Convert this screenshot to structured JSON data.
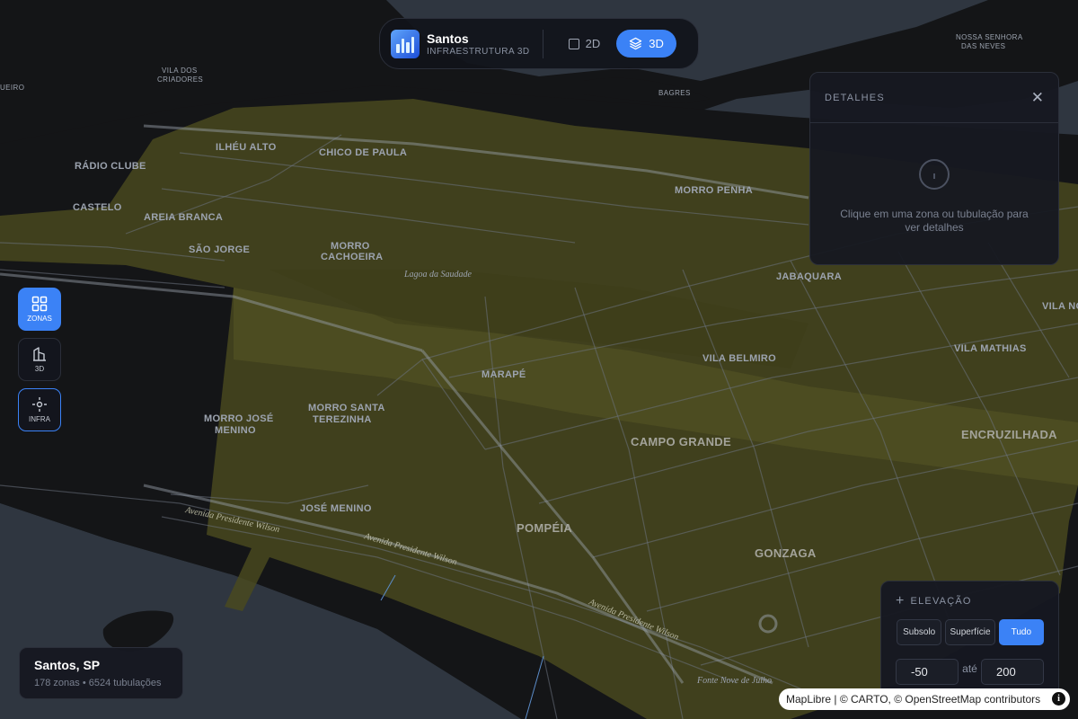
{
  "app": {
    "title": "Santos",
    "subtitle": "INFRAESTRUTURA 3D",
    "modes": [
      {
        "label": "2D",
        "active": false
      },
      {
        "label": "3D",
        "active": true
      }
    ]
  },
  "sidebar": {
    "buttons": [
      {
        "label": "ZONAS",
        "icon": "grid-icon",
        "active": true
      },
      {
        "label": "3D",
        "icon": "building-icon",
        "active": false
      },
      {
        "label": "INFRA",
        "icon": "crosshair-icon",
        "active": false
      }
    ]
  },
  "details": {
    "title": "DETALHES",
    "hint": "Clique em uma zona ou tubulação para ver detalhes"
  },
  "city": {
    "name": "Santos, SP",
    "stats": "178 zonas • 6524 tubulações"
  },
  "elevation": {
    "title": "ELEVAÇÃO",
    "options": [
      {
        "label": "Subsolo",
        "active": false
      },
      {
        "label": "Superfície",
        "active": false
      },
      {
        "label": "Tudo",
        "active": true
      }
    ],
    "min": "-50",
    "max": "200",
    "between": "até"
  },
  "attribution": {
    "text": "MapLibre | © CARTO, © OpenStreetMap contributors"
  },
  "map": {
    "labels": {
      "vila_dos_criadores_1": "VILA DOS",
      "vila_dos_criadores_2": "CRIADORES",
      "ilheu_alto": "ILHÉU ALTO",
      "chico_de_paula": "CHICO DE PAULA",
      "radio_clube": "RÁDIO CLUBE",
      "castelo": "CASTELO",
      "areia_branca": "AREIA BRANCA",
      "sao_jorge": "SÃO JORGE",
      "morro_cachoeira_1": "MORRO",
      "morro_cachoeira_2": "CACHOEIRA",
      "lagoa_saudade": "Lagoa da Saudade",
      "morro_penha": "MORRO PENHA",
      "jabaquara": "JABAQUARA",
      "vila_nova": "VILA NO",
      "vila_mathias": "VILA MATHIAS",
      "marape": "MARAPÉ",
      "vila_belmiro": "VILA BELMIRO",
      "morro_jose_menino_1": "MORRO JOSÉ",
      "morro_jose_menino_2": "MENINO",
      "morro_santa_terezinha_1": "MORRO SANTA",
      "morro_santa_terezinha_2": "TEREZINHA",
      "campo_grande": "CAMPO GRANDE",
      "encruzilhada": "ENCRUZILHADA",
      "jose_menino": "JOSÉ MENINO",
      "pompeia": "POMPÉIA",
      "gonzaga": "GONZAGA",
      "bagres": "BAGRES",
      "nossa_senhora_1": "NOSSA SENHORA",
      "nossa_senhora_2": "DAS NEVES",
      "ueiro": "UEIRO",
      "av_presidente_wilson_1": "Avenida Presidente Wilson",
      "av_presidente_wilson_2": "Avenida Presidente Wilson",
      "av_presidente_wilson_3": "Avenida Presidente Wilson",
      "fonte_nove_julho": "Fonte Nove de Julho"
    }
  },
  "colors": {
    "accent": "#3b82f6",
    "zone_fill": "#4a4a1e",
    "water": "#2f3640",
    "land": "#141517"
  }
}
